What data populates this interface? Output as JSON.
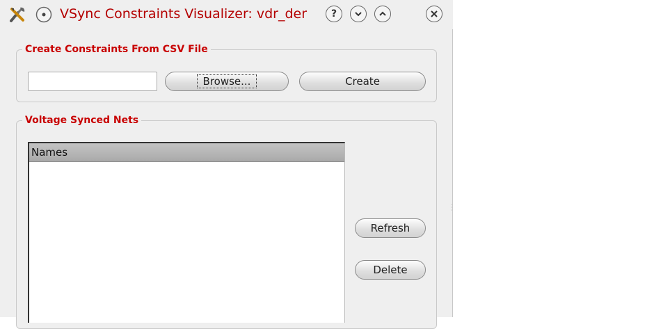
{
  "window": {
    "title": "VSync Constraints Visualizer: vdr_der",
    "icons": {
      "app": "tools-icon",
      "menu": "window-menu-icon",
      "help": "help-icon",
      "minimize": "minimize-icon",
      "maximize": "maximize-icon",
      "close": "close-icon"
    }
  },
  "csv_group": {
    "title": "Create Constraints From CSV File",
    "file_value": "",
    "file_placeholder": "",
    "browse_label": "Browse...",
    "create_label": "Create"
  },
  "nets_group": {
    "title": "Voltage Synced Nets",
    "columns": [
      "Names"
    ],
    "rows": [],
    "refresh_label": "Refresh",
    "delete_label": "Delete"
  },
  "colors": {
    "title_text": "#b40000",
    "group_title": "#c80000",
    "window_bg": "#efefef"
  }
}
